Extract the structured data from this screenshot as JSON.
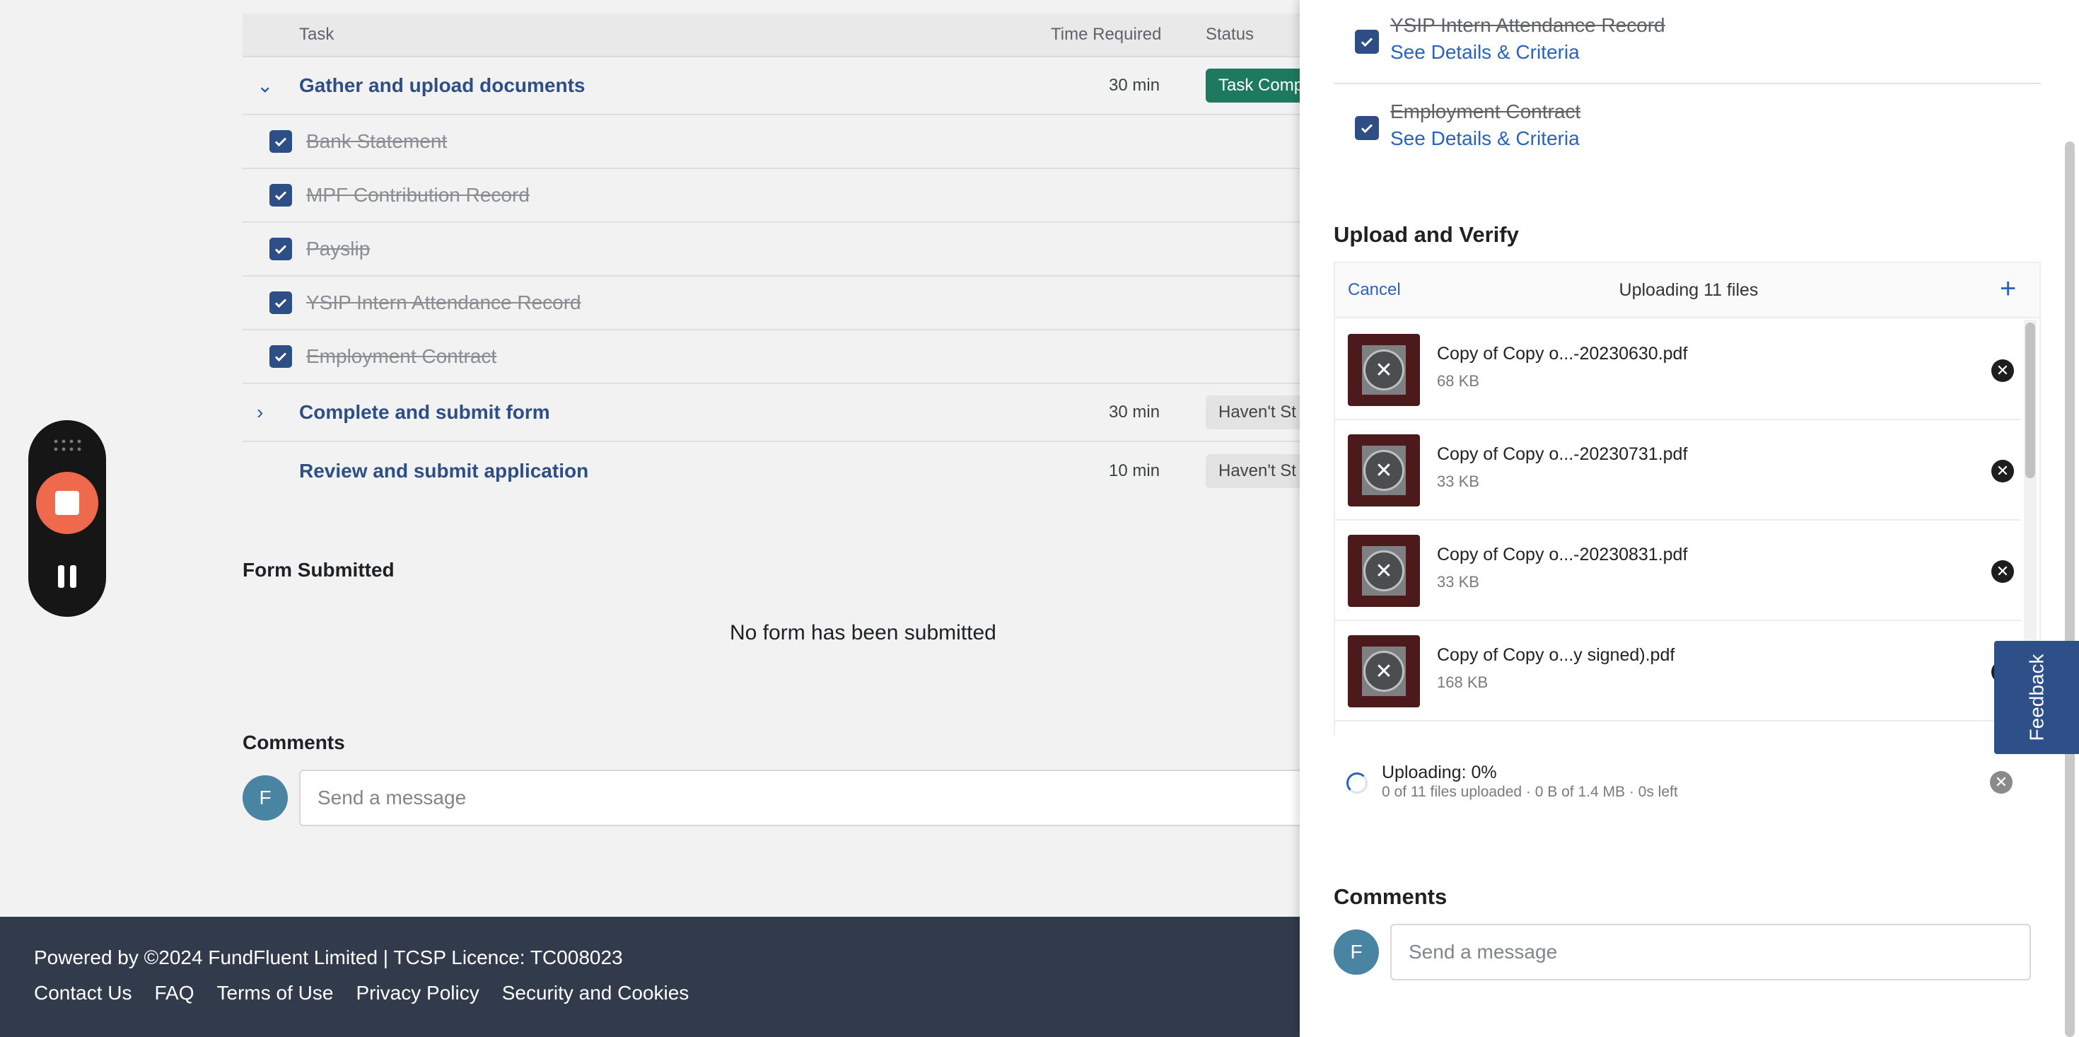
{
  "table": {
    "headers": {
      "task": "Task",
      "time": "Time Required",
      "status": "Status"
    },
    "groups": [
      {
        "title": "Gather and upload documents",
        "time": "30 min",
        "status": "Task Comp",
        "expanded": true,
        "items": [
          "Bank Statement",
          "MPF Contribution Record",
          "Payslip",
          "YSIP Intern Attendance Record",
          "Employment Contract"
        ]
      },
      {
        "title": "Complete and submit form",
        "time": "30 min",
        "status": "Haven't St"
      },
      {
        "title": "Review and submit application",
        "time": "10 min",
        "status": "Haven't St"
      }
    ]
  },
  "form_section": {
    "title": "Form Submitted",
    "empty": "No form has been submitted"
  },
  "comments": {
    "title": "Comments",
    "avatar": "F",
    "placeholder": "Send a message"
  },
  "footer": {
    "copyright": "Powered by ©2024 FundFluent Limited | TCSP Licence: TC008023",
    "links": [
      "Contact Us",
      "FAQ",
      "Terms of Use",
      "Privacy Policy",
      "Security and Cookies"
    ]
  },
  "panel": {
    "documents": [
      {
        "name": "YSIP Intern Attendance Record",
        "link": "See Details & Criteria"
      },
      {
        "name": "Employment Contract",
        "link": "See Details & Criteria"
      }
    ],
    "upload_title": "Upload and Verify",
    "uploader": {
      "cancel": "Cancel",
      "count": "Uploading 11 files",
      "add": "+",
      "files": [
        {
          "name": "Copy of Copy o...-20230630.pdf",
          "size": "68 KB"
        },
        {
          "name": "Copy of Copy o...-20230731.pdf",
          "size": "33 KB"
        },
        {
          "name": "Copy of Copy o...-20230831.pdf",
          "size": "33 KB"
        },
        {
          "name": "Copy of Copy o...y signed).pdf",
          "size": "168 KB"
        }
      ],
      "progress_title": "Uploading: 0%",
      "progress_detail": "0 of 11 files uploaded · 0 B of 1.4 MB · 0s left"
    },
    "comments_title": "Comments",
    "avatar": "F",
    "placeholder": "Send a message"
  },
  "feedback": "Feedback",
  "colors": {
    "primary": "#2e4f86",
    "link": "#2a63b8",
    "done_badge": "#1e7a5f",
    "record": "#ef6a4c",
    "footer": "#323b4b"
  }
}
